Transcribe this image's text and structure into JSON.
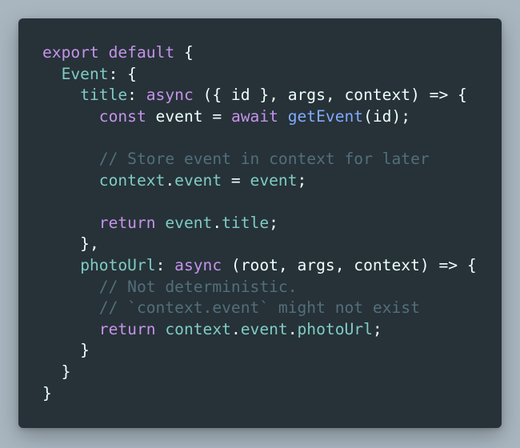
{
  "colors": {
    "background": "#a9b6c0",
    "editor_background": "#263238",
    "keyword": "#c792ea",
    "property": "#80cbc4",
    "function": "#82aaff",
    "comment": "#546e7a",
    "punctuation": "#89ddff",
    "text": "#eeffff"
  },
  "code_lines": [
    [
      {
        "t": "export",
        "k": "keyword"
      },
      {
        "t": " ",
        "k": "plain"
      },
      {
        "t": "default",
        "k": "keyword"
      },
      {
        "t": " {",
        "k": "plain"
      }
    ],
    [
      {
        "t": "  ",
        "k": "plain"
      },
      {
        "t": "Event",
        "k": "prop"
      },
      {
        "t": ": {",
        "k": "plain"
      }
    ],
    [
      {
        "t": "    ",
        "k": "plain"
      },
      {
        "t": "title",
        "k": "prop"
      },
      {
        "t": ": ",
        "k": "plain"
      },
      {
        "t": "async",
        "k": "keyword"
      },
      {
        "t": " ({ id }, args, context) => {",
        "k": "plain"
      }
    ],
    [
      {
        "t": "      ",
        "k": "plain"
      },
      {
        "t": "const",
        "k": "keyword"
      },
      {
        "t": " event = ",
        "k": "plain"
      },
      {
        "t": "await",
        "k": "keyword"
      },
      {
        "t": " ",
        "k": "plain"
      },
      {
        "t": "getEvent",
        "k": "func"
      },
      {
        "t": "(id);",
        "k": "plain"
      }
    ],
    [],
    [
      {
        "t": "      ",
        "k": "plain"
      },
      {
        "t": "// Store event in context for later",
        "k": "comment"
      }
    ],
    [
      {
        "t": "      ",
        "k": "plain"
      },
      {
        "t": "context",
        "k": "prop"
      },
      {
        "t": ".",
        "k": "plain"
      },
      {
        "t": "event",
        "k": "prop"
      },
      {
        "t": " = ",
        "k": "plain"
      },
      {
        "t": "event",
        "k": "prop"
      },
      {
        "t": ";",
        "k": "plain"
      }
    ],
    [],
    [
      {
        "t": "      ",
        "k": "plain"
      },
      {
        "t": "return",
        "k": "keyword"
      },
      {
        "t": " ",
        "k": "plain"
      },
      {
        "t": "event",
        "k": "prop"
      },
      {
        "t": ".",
        "k": "plain"
      },
      {
        "t": "title",
        "k": "prop"
      },
      {
        "t": ";",
        "k": "plain"
      }
    ],
    [
      {
        "t": "    },",
        "k": "plain"
      }
    ],
    [
      {
        "t": "    ",
        "k": "plain"
      },
      {
        "t": "photoUrl",
        "k": "prop"
      },
      {
        "t": ": ",
        "k": "plain"
      },
      {
        "t": "async",
        "k": "keyword"
      },
      {
        "t": " (root, args, context) => {",
        "k": "plain"
      }
    ],
    [
      {
        "t": "      ",
        "k": "plain"
      },
      {
        "t": "// Not deterministic.",
        "k": "comment"
      }
    ],
    [
      {
        "t": "      ",
        "k": "plain"
      },
      {
        "t": "// `context.event` might not exist",
        "k": "comment"
      }
    ],
    [
      {
        "t": "      ",
        "k": "plain"
      },
      {
        "t": "return",
        "k": "keyword"
      },
      {
        "t": " ",
        "k": "plain"
      },
      {
        "t": "context",
        "k": "prop"
      },
      {
        "t": ".",
        "k": "plain"
      },
      {
        "t": "event",
        "k": "prop"
      },
      {
        "t": ".",
        "k": "plain"
      },
      {
        "t": "photoUrl",
        "k": "prop"
      },
      {
        "t": ";",
        "k": "plain"
      }
    ],
    [
      {
        "t": "    }",
        "k": "plain"
      }
    ],
    [
      {
        "t": "  }",
        "k": "plain"
      }
    ],
    [
      {
        "t": "}",
        "k": "plain"
      }
    ]
  ]
}
